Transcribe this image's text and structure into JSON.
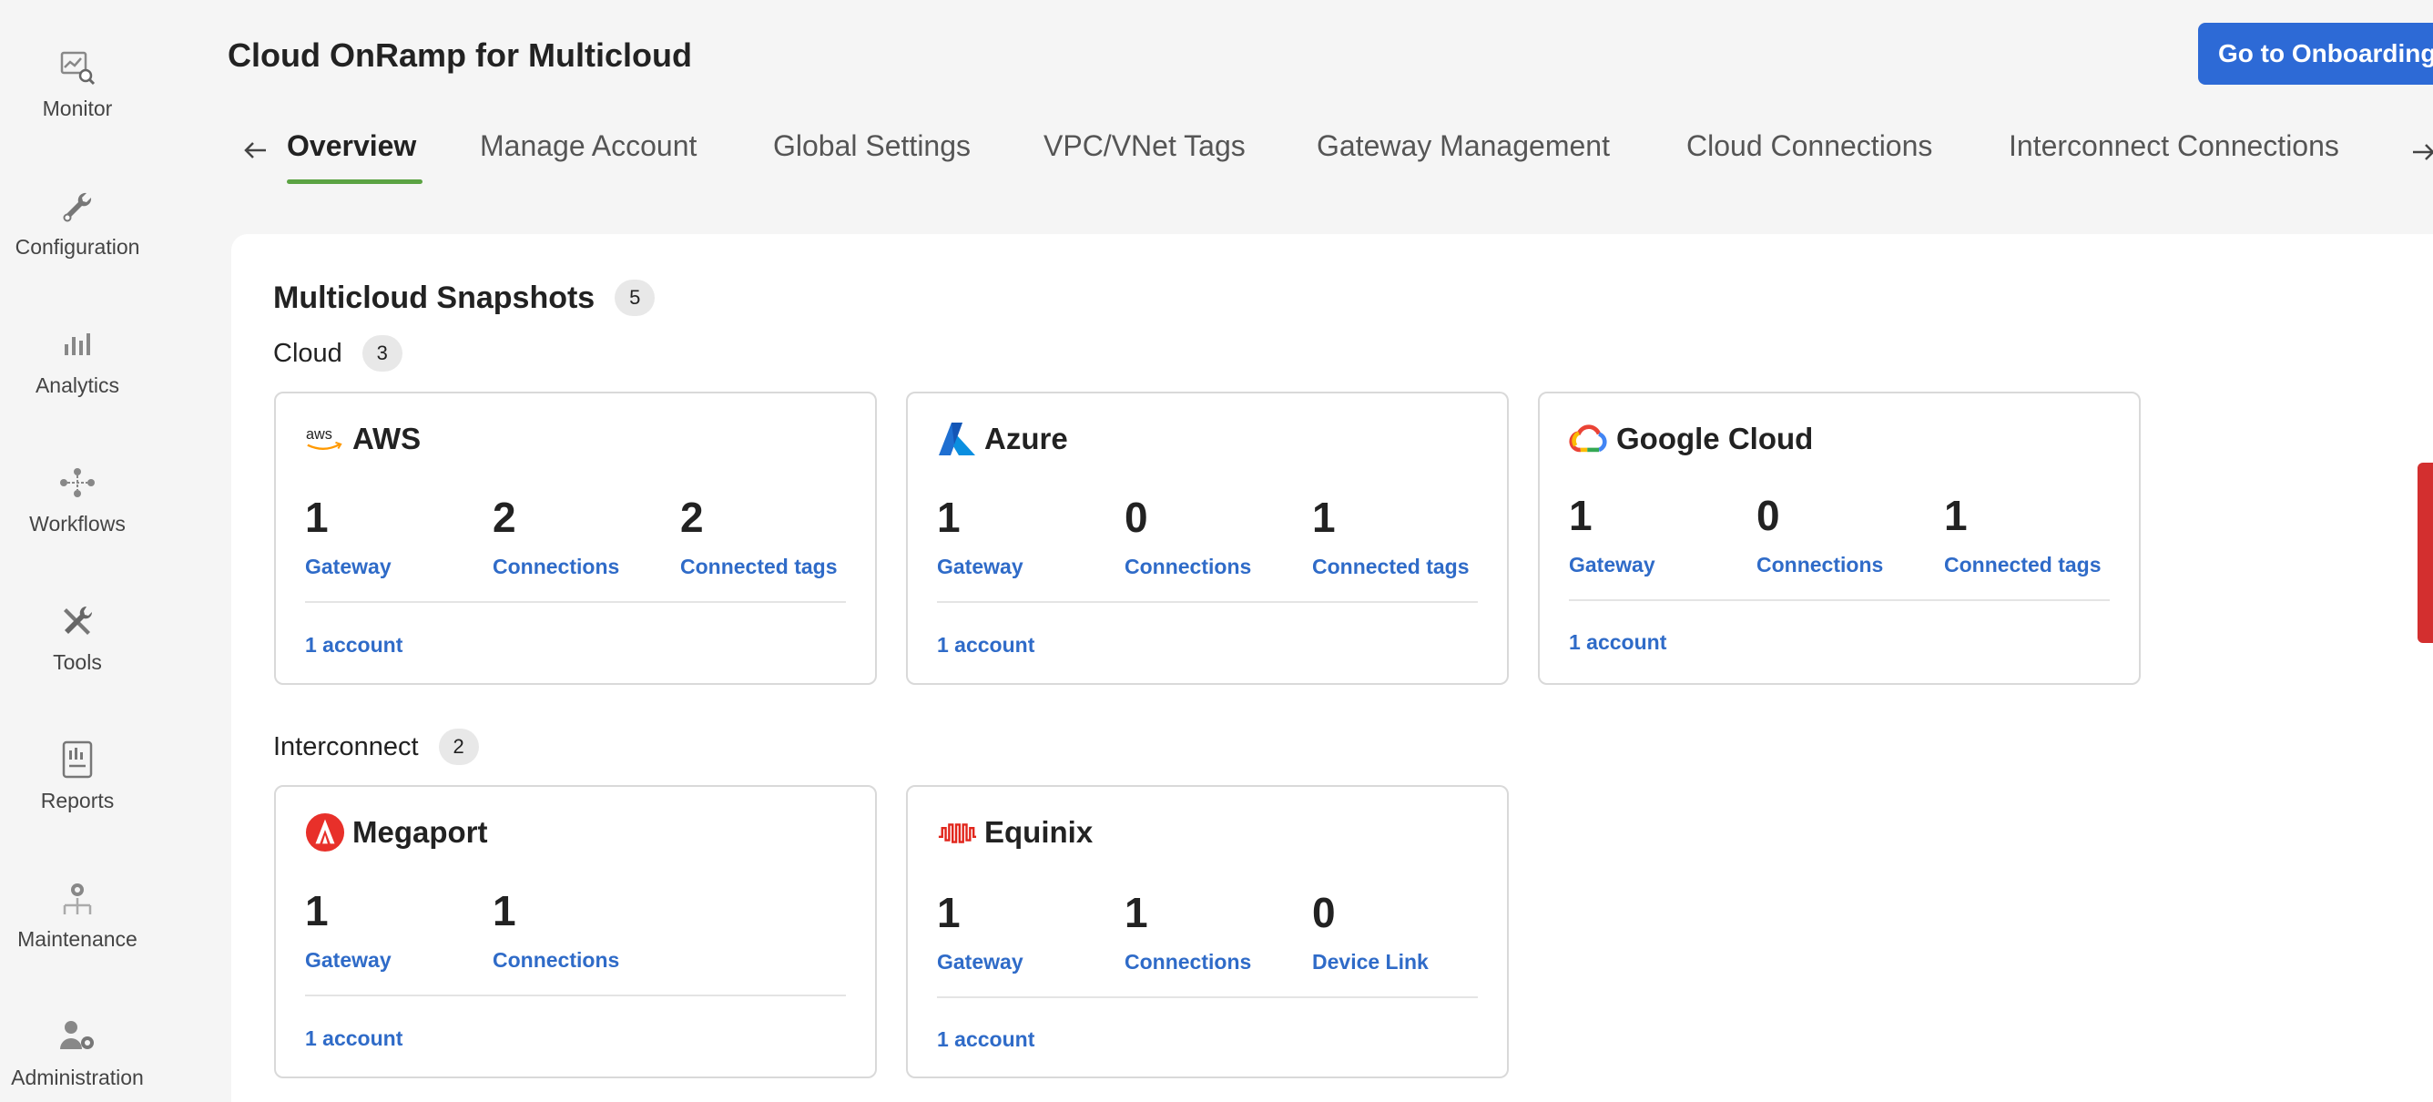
{
  "sidebar": {
    "items": [
      {
        "label": "Monitor",
        "icon": "monitor-icon"
      },
      {
        "label": "Configuration",
        "icon": "wrench-icon"
      },
      {
        "label": "Analytics",
        "icon": "bar-chart-icon"
      },
      {
        "label": "Workflows",
        "icon": "workflow-icon"
      },
      {
        "label": "Tools",
        "icon": "tools-icon"
      },
      {
        "label": "Reports",
        "icon": "report-icon"
      },
      {
        "label": "Maintenance",
        "icon": "maintenance-icon"
      },
      {
        "label": "Administration",
        "icon": "admin-icon"
      }
    ]
  },
  "header": {
    "title": "Cloud OnRamp for Multicloud",
    "onboarding_button": "Go to Onboarding"
  },
  "tabs": [
    {
      "label": "Overview",
      "active": true
    },
    {
      "label": "Manage Account",
      "active": false
    },
    {
      "label": "Global Settings",
      "active": false
    },
    {
      "label": "VPC/VNet Tags",
      "active": false
    },
    {
      "label": "Gateway Management",
      "active": false
    },
    {
      "label": "Cloud Connections",
      "active": false
    },
    {
      "label": "Interconnect Connections",
      "active": false
    }
  ],
  "snapshots": {
    "title": "Multicloud Snapshots",
    "count": "5",
    "cloud": {
      "label": "Cloud",
      "count": "3",
      "cards": [
        {
          "name": "AWS",
          "logo": "aws-logo",
          "metrics": [
            {
              "value": "1",
              "label": "Gateway"
            },
            {
              "value": "2",
              "label": "Connections"
            },
            {
              "value": "2",
              "label": "Connected tags"
            }
          ],
          "account": "1 account"
        },
        {
          "name": "Azure",
          "logo": "azure-logo",
          "metrics": [
            {
              "value": "1",
              "label": "Gateway"
            },
            {
              "value": "0",
              "label": "Connections"
            },
            {
              "value": "1",
              "label": "Connected tags"
            }
          ],
          "account": "1 account"
        },
        {
          "name": "Google Cloud",
          "logo": "google-cloud-logo",
          "metrics": [
            {
              "value": "1",
              "label": "Gateway"
            },
            {
              "value": "0",
              "label": "Connections"
            },
            {
              "value": "1",
              "label": "Connected tags"
            }
          ],
          "account": "1 account"
        }
      ]
    },
    "interconnect": {
      "label": "Interconnect",
      "count": "2",
      "cards": [
        {
          "name": "Megaport",
          "logo": "megaport-logo",
          "metrics": [
            {
              "value": "1",
              "label": "Gateway"
            },
            {
              "value": "1",
              "label": "Connections"
            }
          ],
          "account": "1 account"
        },
        {
          "name": "Equinix",
          "logo": "equinix-logo",
          "metrics": [
            {
              "value": "1",
              "label": "Gateway"
            },
            {
              "value": "1",
              "label": "Connections"
            },
            {
              "value": "0",
              "label": "Device Link"
            }
          ],
          "account": "1 account"
        }
      ]
    }
  },
  "colors": {
    "accent_blue": "#2d6ad6",
    "link_blue": "#2f6bc8",
    "active_tab_underline": "#5ba343",
    "alert_red": "#d32f2f"
  }
}
